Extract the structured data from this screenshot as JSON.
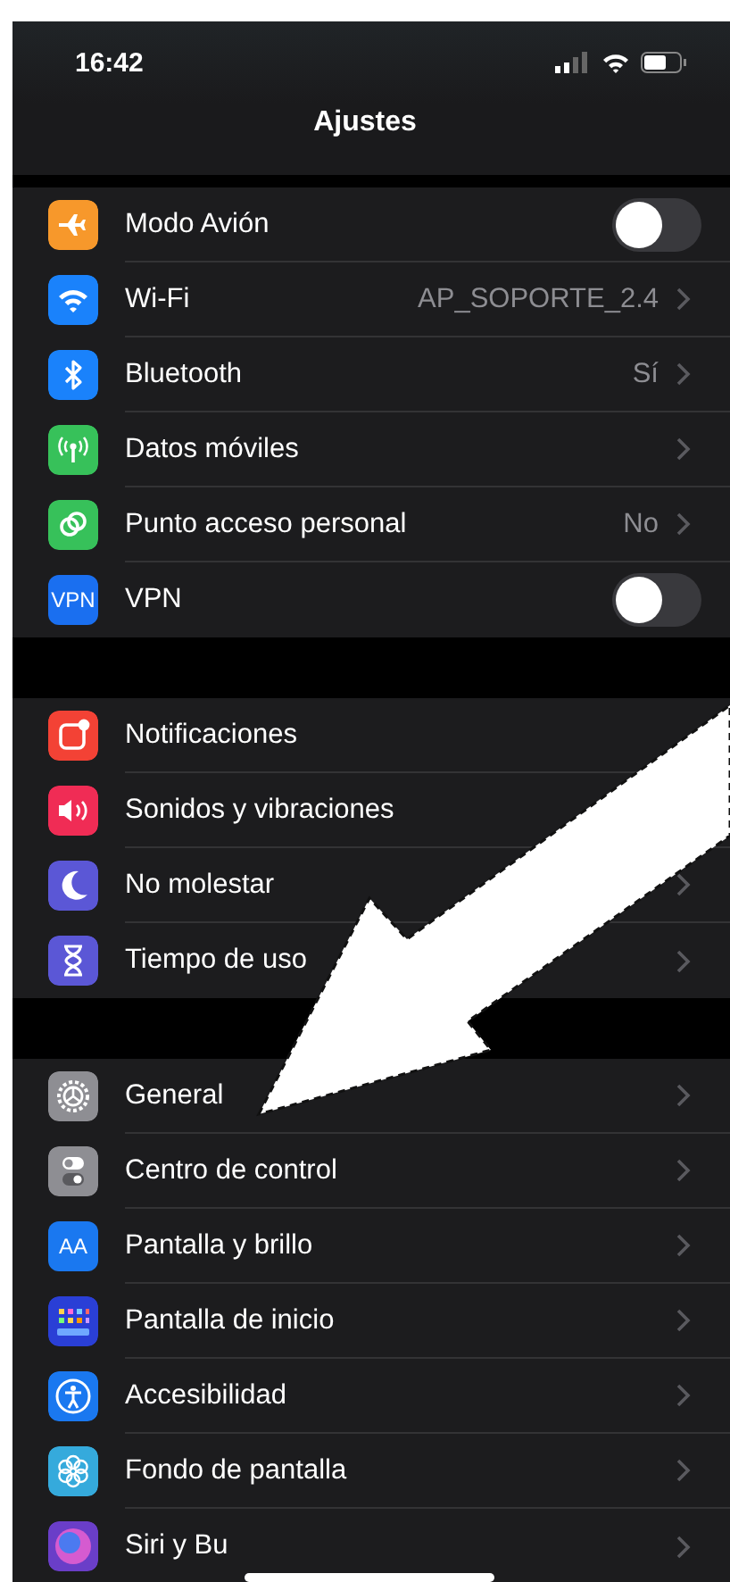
{
  "status_bar": {
    "time": "16:42"
  },
  "nav_bar": {
    "title": "Ajustes"
  },
  "groups": [
    {
      "rows": [
        {
          "label": "Modo Avión",
          "kind": "toggle",
          "on": false,
          "color": "#f7982b"
        },
        {
          "label": "Wi-Fi",
          "kind": "link",
          "value": "AP_SOPORTE_2.4",
          "chevron": true,
          "color": "#1a82fb"
        },
        {
          "label": "Bluetooth",
          "kind": "link",
          "value": "Sí",
          "chevron": true,
          "color": "#1a82fb"
        },
        {
          "label": "Datos móviles",
          "kind": "link",
          "chevron": true,
          "color": "#37c15a"
        },
        {
          "label": "Punto acceso personal",
          "kind": "link",
          "value": "No",
          "chevron": true,
          "color": "#37c15a"
        },
        {
          "label": "VPN",
          "kind": "toggle",
          "on": false,
          "color": "#1a6ff0",
          "badge": "VPN"
        }
      ]
    },
    {
      "rows": [
        {
          "label": "Notificaciones",
          "kind": "link",
          "chevron": false,
          "color": "#f34235"
        },
        {
          "label": "Sonidos y vibraciones",
          "kind": "link",
          "chevron": false,
          "color": "#f02c55"
        },
        {
          "label": "No molestar",
          "kind": "link",
          "chevron": true,
          "color": "#5b57d6"
        },
        {
          "label": "Tiempo de uso",
          "kind": "link",
          "chevron": true,
          "color": "#5b57d6"
        }
      ]
    },
    {
      "rows": [
        {
          "label": "General",
          "kind": "link",
          "chevron": true,
          "color": "#8e8e93"
        },
        {
          "label": "Centro de control",
          "kind": "link",
          "chevron": true,
          "color": "#8e8e93"
        },
        {
          "label": "Pantalla y brillo",
          "kind": "link",
          "chevron": true,
          "color": "#1a78f0",
          "badge": "AA"
        },
        {
          "label": "Pantalla de inicio",
          "kind": "link",
          "chevron": true,
          "color": "#2a3fd6"
        },
        {
          "label": "Accesibilidad",
          "kind": "link",
          "chevron": true,
          "color": "#1a78f0"
        },
        {
          "label": "Fondo de pantalla",
          "kind": "link",
          "chevron": true,
          "color": "#35aadc"
        },
        {
          "label": "Siri y Bu",
          "kind": "link",
          "chevron": true,
          "color": "#6a3ec8"
        }
      ]
    }
  ]
}
